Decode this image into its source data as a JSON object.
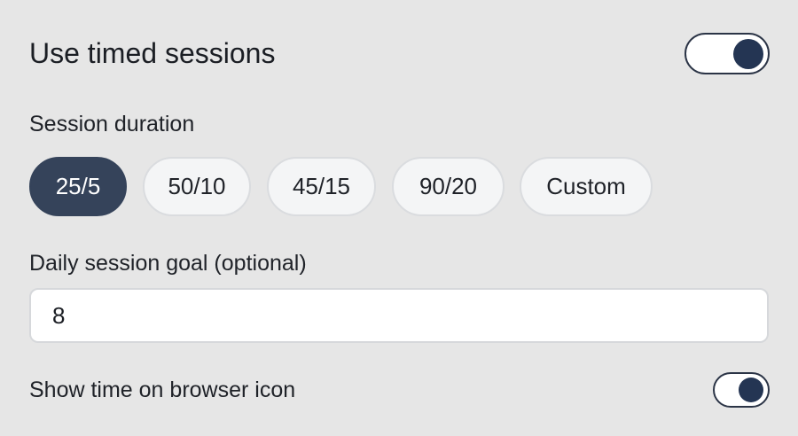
{
  "timed_sessions": {
    "label": "Use timed sessions",
    "enabled": true
  },
  "session_duration": {
    "label": "Session duration",
    "options": [
      {
        "label": "25/5",
        "selected": true
      },
      {
        "label": "50/10",
        "selected": false
      },
      {
        "label": "45/15",
        "selected": false
      },
      {
        "label": "90/20",
        "selected": false
      },
      {
        "label": "Custom",
        "selected": false
      }
    ]
  },
  "daily_goal": {
    "label": "Daily session goal (optional)",
    "value": "8"
  },
  "browser_icon": {
    "label": "Show time on browser icon",
    "enabled": true
  },
  "colors": {
    "background": "#e6e6e6",
    "accent": "#35435a",
    "toggle_knob": "#243553"
  }
}
